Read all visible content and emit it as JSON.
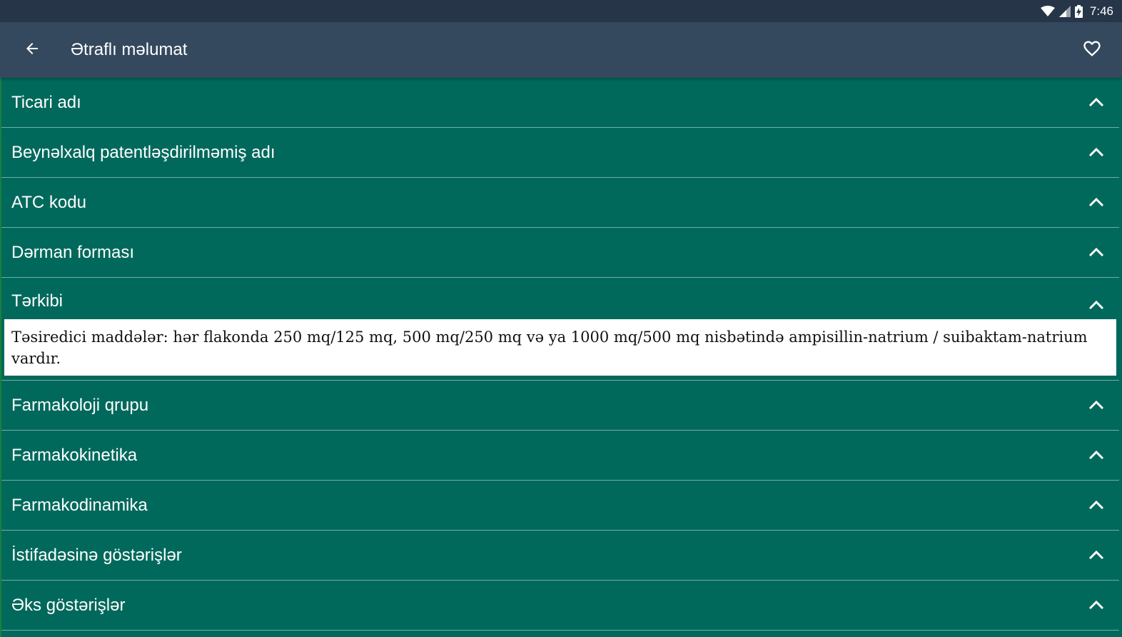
{
  "status_bar": {
    "time": "7:46",
    "icons": [
      "wifi-icon",
      "signal-icon",
      "battery-charging-icon"
    ]
  },
  "app_bar": {
    "back_icon": "arrow-left-icon",
    "title": "Ətraflı məlumat",
    "favorite_icon": "heart-outline-icon"
  },
  "colors": {
    "status_bar": "#263548",
    "app_bar": "#34495e",
    "section_background": "#00695c",
    "detail_background": "#ffffff"
  },
  "sections": [
    {
      "label": "Ticari adı"
    },
    {
      "label": "Beynəlxalq patentləşdirilməmiş adı"
    },
    {
      "label": "ATC kodu"
    },
    {
      "label": "Dərman forması"
    },
    {
      "label": "Tərkibi",
      "content": "Təsiredici maddələr: hər flakonda 250 mq/125 mq, 500 mq/250 mq və ya 1000 mq/500 mq nisbətində ampisillin-natrium / suibaktam-natrium vardır."
    },
    {
      "label": "Farmakoloji qrupu"
    },
    {
      "label": "Farmakokinetika"
    },
    {
      "label": "Farmakodinamika"
    },
    {
      "label": "İstifadəsinə göstərişlər"
    },
    {
      "label": "Əks göstərişlər"
    }
  ]
}
